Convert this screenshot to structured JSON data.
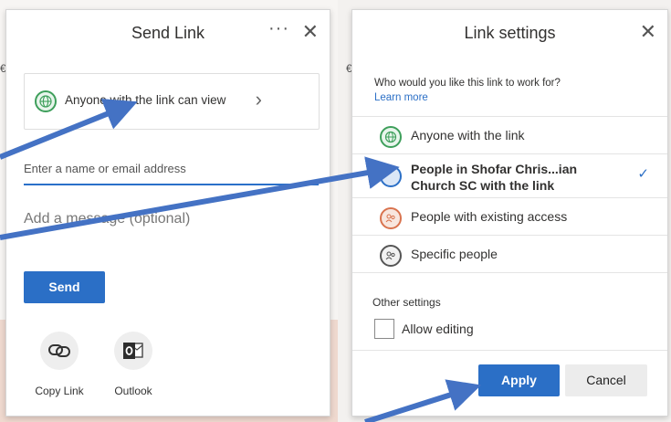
{
  "send_link": {
    "title": "Send Link",
    "more_label": "···",
    "close_label": "✕",
    "link_summary": "Anyone with the link can view",
    "email_placeholder": "Enter a name or email address",
    "message_placeholder": "Add a message (optional)",
    "send_label": "Send",
    "share_options": [
      {
        "label": "Copy Link",
        "icon": "copy-link-icon"
      },
      {
        "label": "Outlook",
        "icon": "outlook-icon"
      }
    ]
  },
  "link_settings": {
    "title": "Link settings",
    "close_label": "✕",
    "question": "Who would you like this link to work for?",
    "learn_more": "Learn more",
    "options": [
      {
        "label": "Anyone with the link",
        "icon": "globe-icon",
        "selected": false
      },
      {
        "label_line1": "People in Shofar Chris...ian",
        "label_line2": "Church SC with the link",
        "icon": "organization-icon",
        "selected": true
      },
      {
        "label": "People with existing access",
        "icon": "people-icon",
        "selected": false
      },
      {
        "label": "Specific people",
        "icon": "specific-people-icon",
        "selected": false
      }
    ],
    "check_mark": "✓",
    "other_settings_label": "Other settings",
    "allow_editing_label": "Allow editing",
    "allow_editing_checked": false,
    "apply_label": "Apply",
    "cancel_label": "Cancel"
  },
  "colors": {
    "accent_blue": "#2b6fc6",
    "globe_green": "#3e9f5b",
    "people_orange": "#d9734e",
    "arrow_blue": "#4472c4"
  }
}
